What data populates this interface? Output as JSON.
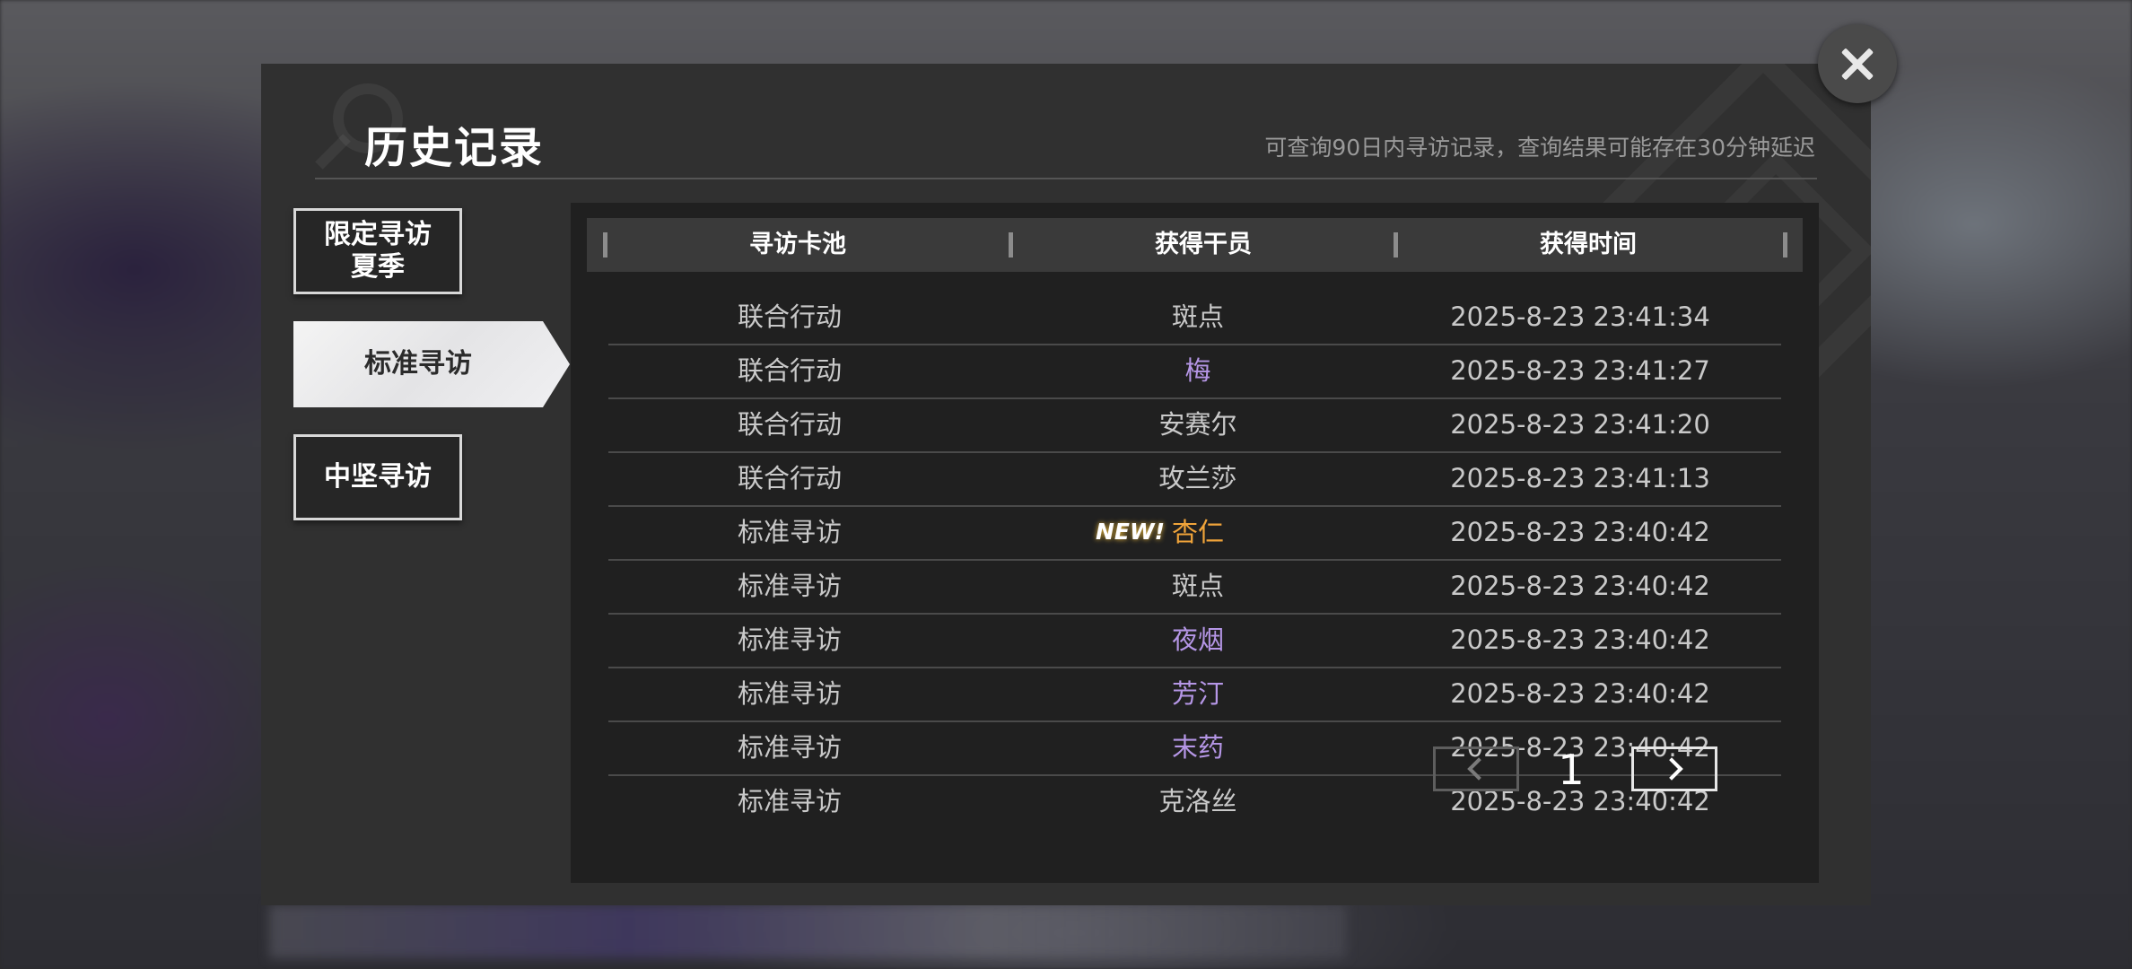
{
  "dialog": {
    "title": "历史记录",
    "notice": "可查询90日内寻访记录，查询结果可能存在30分钟延迟"
  },
  "sidebar": {
    "items": [
      {
        "label_line1": "限定寻访",
        "label_line2": "夏季",
        "active": false
      },
      {
        "label": "标准寻访",
        "active": true
      },
      {
        "label": "中坚寻访",
        "active": false
      }
    ]
  },
  "table": {
    "headers": [
      "寻访卡池",
      "获得干员",
      "获得时间"
    ],
    "rows": [
      {
        "pool": "联合行动",
        "operator": "斑点",
        "time": "2025-8-23 23:41:34",
        "color": "#c9c9c9",
        "new": false
      },
      {
        "pool": "联合行动",
        "operator": "梅",
        "time": "2025-8-23 23:41:27",
        "color": "#b596e6",
        "new": false
      },
      {
        "pool": "联合行动",
        "operator": "安赛尔",
        "time": "2025-8-23 23:41:20",
        "color": "#c9c9c9",
        "new": false
      },
      {
        "pool": "联合行动",
        "operator": "玫兰莎",
        "time": "2025-8-23 23:41:13",
        "color": "#c9c9c9",
        "new": false
      },
      {
        "pool": "标准寻访",
        "operator": "杏仁",
        "time": "2025-8-23 23:40:42",
        "color": "#f0a43a",
        "new": true
      },
      {
        "pool": "标准寻访",
        "operator": "斑点",
        "time": "2025-8-23 23:40:42",
        "color": "#c9c9c9",
        "new": false
      },
      {
        "pool": "标准寻访",
        "operator": "夜烟",
        "time": "2025-8-23 23:40:42",
        "color": "#b596e6",
        "new": false
      },
      {
        "pool": "标准寻访",
        "operator": "芳汀",
        "time": "2025-8-23 23:40:42",
        "color": "#b596e6",
        "new": false
      },
      {
        "pool": "标准寻访",
        "operator": "末药",
        "time": "2025-8-23 23:40:42",
        "color": "#b596e6",
        "new": false
      },
      {
        "pool": "标准寻访",
        "operator": "克洛丝",
        "time": "2025-8-23 23:40:42",
        "color": "#c9c9c9",
        "new": false
      }
    ],
    "new_label": "NEW!"
  },
  "pagination": {
    "current_page": "1",
    "prev_icon": "chevron-left-icon",
    "next_icon": "chevron-right-icon"
  },
  "close_icon": "close-icon"
}
